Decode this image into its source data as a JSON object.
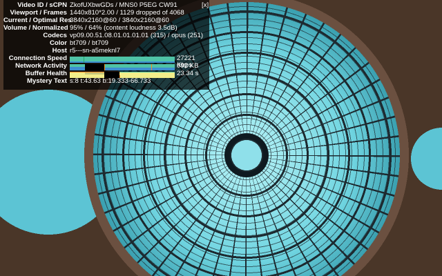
{
  "stats": [
    {
      "label": "Video ID / sCPN",
      "value": "ZkofUXbwGDs / MNS0 P5EG CW91"
    },
    {
      "label": "Viewport / Frames",
      "value": "1440x810*2.00 / 1129 dropped of 4068"
    },
    {
      "label": "Current / Optimal Res",
      "value": "3840x2160@60 / 3840x2160@60"
    },
    {
      "label": "Volume / Normalized",
      "value": "95% / 64% (content loudness 3.5dB)"
    },
    {
      "label": "Codecs",
      "value": "vp09.00.51.08.01.01.01.01 (315) / opus (251)"
    },
    {
      "label": "Color",
      "value": "bt709 / bt709"
    },
    {
      "label": "Host",
      "value": "r5---sn-a5meknl7"
    }
  ],
  "graphs": {
    "connection_speed": {
      "label": "Connection Speed",
      "value": "27221 Kbps"
    },
    "network_activity": {
      "label": "Network Activity",
      "value": "992 KB"
    },
    "buffer_health": {
      "label": "Buffer Health",
      "value": "23.34 s"
    }
  },
  "mystery": {
    "label": "Mystery Text",
    "value": "s:8 t:43.63 b:19.333-66.733"
  },
  "close_label": "[x]",
  "colors": {
    "speed": "#4fc3a6",
    "network": "#3d8fd1",
    "buffer": "#f2ee8a",
    "accent": "#f08a24"
  }
}
